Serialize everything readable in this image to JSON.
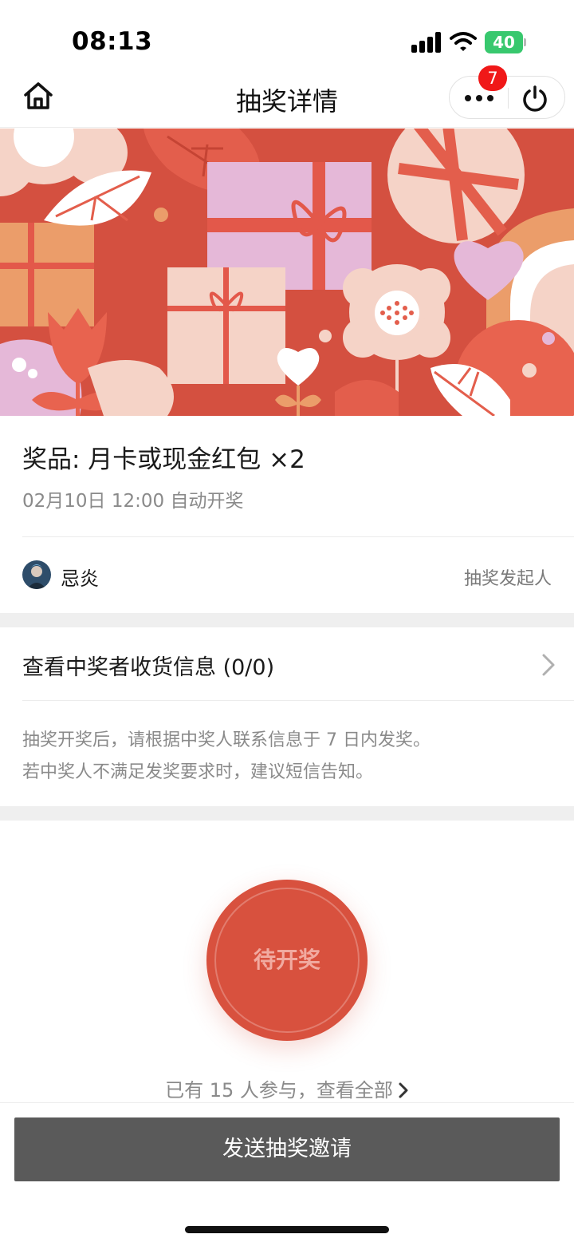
{
  "status_bar": {
    "time": "08:13",
    "battery": "40"
  },
  "nav": {
    "title": "抽奖详情",
    "badge_count": "7",
    "icons": [
      "home-icon",
      "more-icon",
      "power-icon"
    ]
  },
  "prize": {
    "title": "奖品: 月卡或现金红包 ×2",
    "draw_time": "02月10日 12:00 自动开奖"
  },
  "initiator": {
    "name": "忌炎",
    "role": "抽奖发起人"
  },
  "winner_info": {
    "label": "查看中奖者收货信息 (0/0)"
  },
  "notice": {
    "line1": "抽奖开奖后，请根据中奖人联系信息于 7 日内发奖。",
    "line2": "若中奖人不满足发奖要求时，建议短信告知。"
  },
  "draw": {
    "status_label": "待开奖"
  },
  "participants": {
    "text": "已有 15 人参与，查看全部"
  },
  "invite": {
    "label": "发送抽奖邀请"
  },
  "colors": {
    "accent": "#d8513e",
    "badge": "#f01818",
    "battery": "#38c86e",
    "invite_button": "#5a5a5a"
  }
}
